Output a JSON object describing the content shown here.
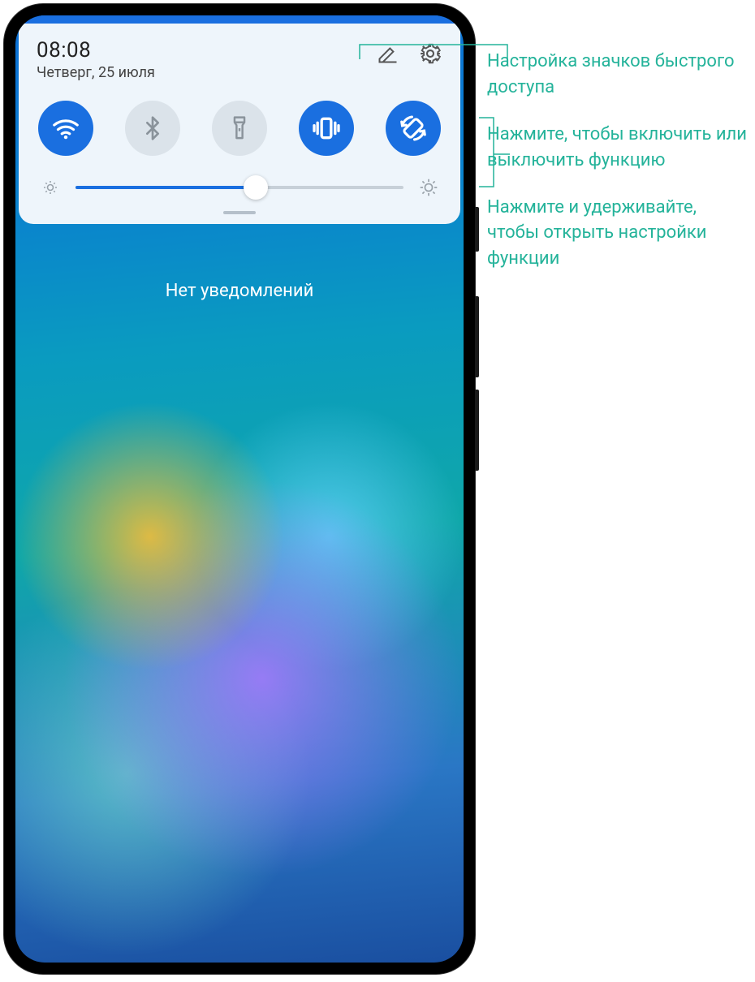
{
  "statusbar": {
    "time": "08:08",
    "date": "Четверг, 25 июля"
  },
  "toggles": [
    {
      "name": "wifi",
      "active": true
    },
    {
      "name": "bluetooth",
      "active": false
    },
    {
      "name": "flashlight",
      "active": false
    },
    {
      "name": "vibrate",
      "active": true
    },
    {
      "name": "autorotate",
      "active": true
    }
  ],
  "brightness": {
    "percent": 55
  },
  "notifications": {
    "empty_text": "Нет уведомлений"
  },
  "callouts": {
    "edit_icons": "Настройка значков быстрого доступа",
    "tap_toggle": "Нажмите, чтобы включить или выключить функцию",
    "hold_settings": "Нажмите и удерживайте, чтобы открыть настройки функции"
  },
  "colors": {
    "accent": "#1a6fe0",
    "toggle_off": "#dbe3ea",
    "callout": "#24b39a"
  }
}
